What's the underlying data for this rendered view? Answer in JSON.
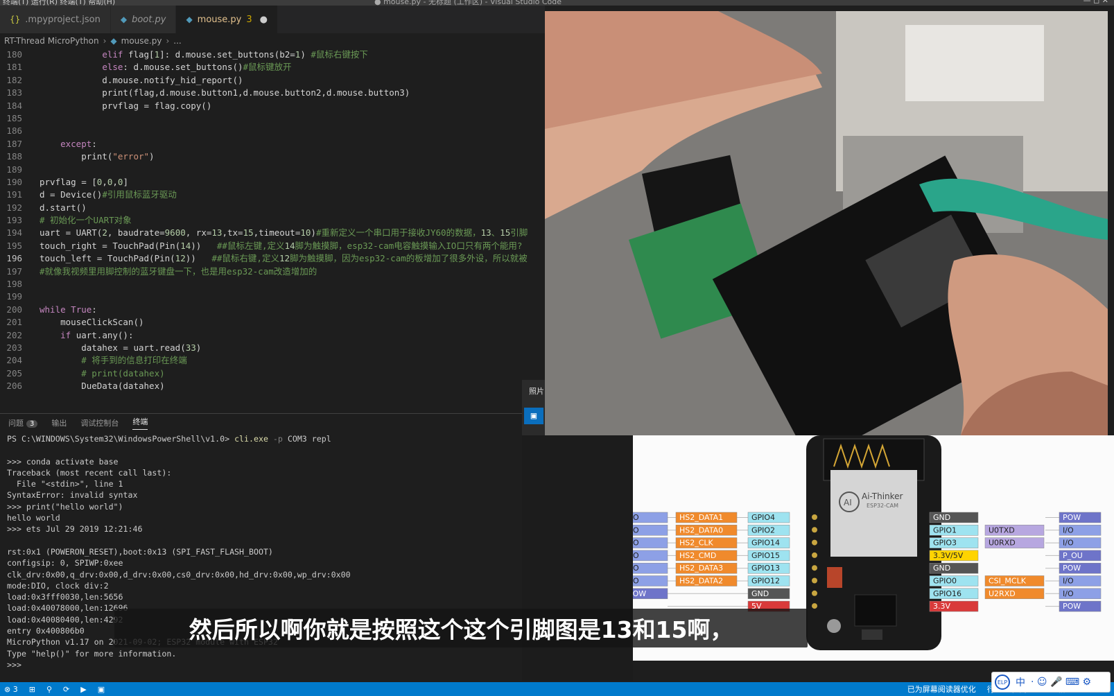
{
  "titlebar": {
    "menu": "终端(T)  运行(R)  终端(T)  帮助(H)",
    "title": "● mouse.py - 无标题 (工作区) - Visual Studio Code",
    "controls": "—   ◻   ✕"
  },
  "tabs": [
    {
      "icon": "{}",
      "label": ".mpyproject.json",
      "extra": ""
    },
    {
      "icon": "◆",
      "label": "boot.py",
      "extra": ""
    },
    {
      "icon": "◆",
      "label": "mouse.py",
      "extra": "3"
    }
  ],
  "breadcrumb": {
    "root": "RT-Thread MicroPython",
    "file": "mouse.py",
    "tail": "..."
  },
  "editor": {
    "lines": [
      {
        "n": "180",
        "code": "            elif flag[1]: d.mouse.set_buttons(b2=1) #鼠标右键按下"
      },
      {
        "n": "181",
        "code": "            else: d.mouse.set_buttons()#鼠标键放开"
      },
      {
        "n": "182",
        "code": "            d.mouse.notify_hid_report()"
      },
      {
        "n": "183",
        "code": "            print(flag,d.mouse.button1,d.mouse.button2,d.mouse.button3)"
      },
      {
        "n": "184",
        "code": "            prvflag = flag.copy()"
      },
      {
        "n": "185",
        "code": ""
      },
      {
        "n": "186",
        "code": ""
      },
      {
        "n": "187",
        "code": "    except:"
      },
      {
        "n": "188",
        "code": "        print(\"error\")"
      },
      {
        "n": "189",
        "code": ""
      },
      {
        "n": "190",
        "code": "prvflag = [0,0,0]"
      },
      {
        "n": "191",
        "code": "d = Device()#引用鼠标蓝牙驱动"
      },
      {
        "n": "192",
        "code": "d.start()"
      },
      {
        "n": "193",
        "code": "# 初始化一个UART对象"
      },
      {
        "n": "194",
        "code": "uart = UART(2, baudrate=9600, rx=13,tx=15,timeout=10)#重新定义一个串口用于接收JY60的数据，13、15引脚"
      },
      {
        "n": "195",
        "code": "touch_right = TouchPad(Pin(14))   ##鼠标左键,定义14脚为触摸脚，esp32-cam电容触摸输入IO口只有两个能用?"
      },
      {
        "n": "196",
        "code": "touch_left = TouchPad(Pin(12))   ##鼠标右键,定义12脚为触摸脚，因为esp32-cam的板增加了很多外设，所以就被"
      },
      {
        "n": "197",
        "code": "#就像我视频里用脚控制的蓝牙键盘一下，也是用esp32-cam改造增加的"
      },
      {
        "n": "198",
        "code": ""
      },
      {
        "n": "199",
        "code": ""
      },
      {
        "n": "200",
        "code": "while True:"
      },
      {
        "n": "201",
        "code": "    mouseClickScan()"
      },
      {
        "n": "202",
        "code": "    if uart.any():"
      },
      {
        "n": "203",
        "code": "        datahex = uart.read(33)"
      },
      {
        "n": "204",
        "code": "        # 将手到的信息打印在终端"
      },
      {
        "n": "205",
        "code": "        # print(datahex)"
      },
      {
        "n": "206",
        "code": "        DueData(datahex)"
      }
    ]
  },
  "panel": {
    "tabs": [
      {
        "label": "问题",
        "badge": "3"
      },
      {
        "label": "输出",
        "badge": ""
      },
      {
        "label": "调试控制台",
        "badge": ""
      },
      {
        "label": "终端",
        "badge": ""
      }
    ],
    "prompt": {
      "path": "PS C:\\WINDOWS\\System32\\WindowsPowerShell\\v1.0> ",
      "cmd": "cli.exe",
      "flag": " -p",
      "rest": " COM3 repl"
    },
    "lines": [
      "",
      ">>> conda activate base",
      "Traceback (most recent call last):",
      "  File \"<stdin>\", line 1",
      "SyntaxError: invalid syntax",
      ">>> print(\"hello world\")",
      "hello world",
      ">>> ets Jul 29 2019 12:21:46",
      "",
      "rst:0x1 (POWERON_RESET),boot:0x13 (SPI_FAST_FLASH_BOOT)",
      "configsip: 0, SPIWP:0xee",
      "clk_drv:0x00,q_drv:0x00,d_drv:0x00,cs0_drv:0x00,hd_drv:0x00,wp_drv:0x00",
      "mode:DIO, clock div:2",
      "load:0x3fff0030,len:5656",
      "load:0x40078000,len:12696",
      "load:0x40080400,len:4292",
      "entry 0x400806b0",
      "MicroPython v1.17 on 2021-09-02; ESP32 module with ESP32",
      "Type \"help()\" for more information.",
      ">>> "
    ]
  },
  "statusbar": {
    "left": [
      "⊗ 3",
      "⊞",
      "⚲",
      "⟳",
      "▶",
      "▣"
    ],
    "right": [
      "已为屏幕阅读器优化",
      "行 196，列 50",
      "空格: 4",
      "UTF-8"
    ]
  },
  "overlay": {
    "photo_side_label": "照片",
    "subtitle": "然后所以啊你就是按照这个这个引脚图是13和15啊，",
    "ime": {
      "logo": "ELP",
      "lang": "中",
      "items": "·  ☺  🎤  ⌨  ⚙"
    }
  },
  "pinout": {
    "brand": "Ai-Thinker",
    "model": "ESP32-CAM",
    "left_io": [
      "I/O",
      "I/O",
      "I/O",
      "I/O",
      "I/O",
      "I/O",
      "POW"
    ],
    "left_func": [
      "HS2_DATA1",
      "HS2_DATA0",
      "HS2_CLK",
      "HS2_CMD",
      "HS2_DATA3",
      "HS2_DATA2"
    ],
    "left_gpio": [
      "GPIO4",
      "GPIO2",
      "GPIO14",
      "GPIO15",
      "GPIO13",
      "GPIO12",
      "GND",
      "5V"
    ],
    "right_pin": [
      "GND",
      "GPIO1",
      "GPIO3",
      "3.3V/5V",
      "GND",
      "GPIO0",
      "GPIO16",
      "3.3V"
    ],
    "right_func": [
      "",
      "U0TXD",
      "U0RXD",
      "",
      "",
      "CSI_MCLK",
      "U2RXD",
      ""
    ],
    "right_io": [
      "POW",
      "I/O",
      "I/O",
      "P_OU",
      "POW",
      "I/O",
      "I/O",
      "POW"
    ],
    "colors": {
      "io": "#8da0e6",
      "func": "#f08a2c",
      "gpio": "#9ee3f0",
      "gnd": "#555555",
      "v33": "#d93a3a",
      "v5": "#ffd400",
      "uart": "#b7a7e0"
    }
  }
}
